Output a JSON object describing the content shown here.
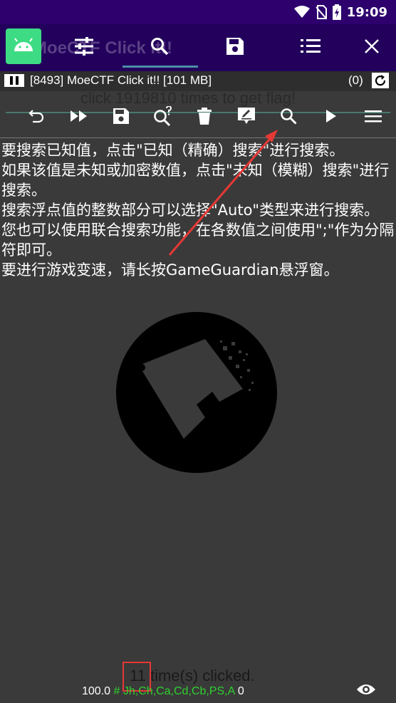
{
  "status_bar": {
    "time": "19:09",
    "icons": [
      "wifi-icon",
      "no-sim-icon",
      "battery-charging-icon"
    ]
  },
  "app": {
    "title": "MoeCTF Click it!!",
    "icon": "android-app-icon"
  },
  "gg_toolbar": {
    "tools": [
      {
        "name": "settings-tab",
        "icon": "sliders-icon"
      },
      {
        "name": "search-tab",
        "icon": "search-icon",
        "active": true
      },
      {
        "name": "saved-list-tab",
        "icon": "floppy-disk-icon"
      },
      {
        "name": "memory-list-tab",
        "icon": "list-icon"
      },
      {
        "name": "close-button",
        "icon": "close-icon"
      }
    ],
    "accent": "#4d8fa8"
  },
  "process": {
    "label": "[8493] MoeCTF Click it!! [101 MB]",
    "count": "(0)"
  },
  "background_hint": "click 1919810 times to get flag!",
  "actions": [
    {
      "name": "undo-button",
      "icon": "undo-icon"
    },
    {
      "name": "fast-forward-button",
      "icon": "fast-forward-icon"
    },
    {
      "name": "save-button",
      "icon": "save-icon"
    },
    {
      "name": "fuzzy-search-button",
      "icon": "search-question-icon"
    },
    {
      "name": "delete-button",
      "icon": "trash-icon"
    },
    {
      "name": "edit-button",
      "icon": "edit-icon"
    },
    {
      "name": "search-button",
      "icon": "search-icon"
    },
    {
      "name": "play-button",
      "icon": "play-icon"
    },
    {
      "name": "menu-button",
      "icon": "menu-icon"
    }
  ],
  "help_text": [
    "要搜索已知值，点击\"已知（精确）搜索\"进行搜索。",
    "如果该值是未知或加密数值，点击\"未知（模糊）搜索\"进行搜索。",
    "搜索浮点值的整数部分可以选择\"Auto\"类型来进行搜索。",
    "您也可以使用联合搜索功能，在各数值之间使用\";\"作为分隔符即可。",
    "要进行游戏变速，请长按GameGuardian悬浮窗。"
  ],
  "clicks": {
    "count": "11",
    "suffix": "time(s) clicked."
  },
  "bottom_status": {
    "speed": "100.0",
    "hash": "#",
    "types": "Jh,Ch,Ca,Cd,Cb,PS,A",
    "count": "0"
  },
  "colors": {
    "status_bar": "#2d006e",
    "app_bar": "#22005c",
    "panel": "#3a3a3a",
    "highlight_red": "#e53935",
    "types_green": "#2ed12e"
  }
}
